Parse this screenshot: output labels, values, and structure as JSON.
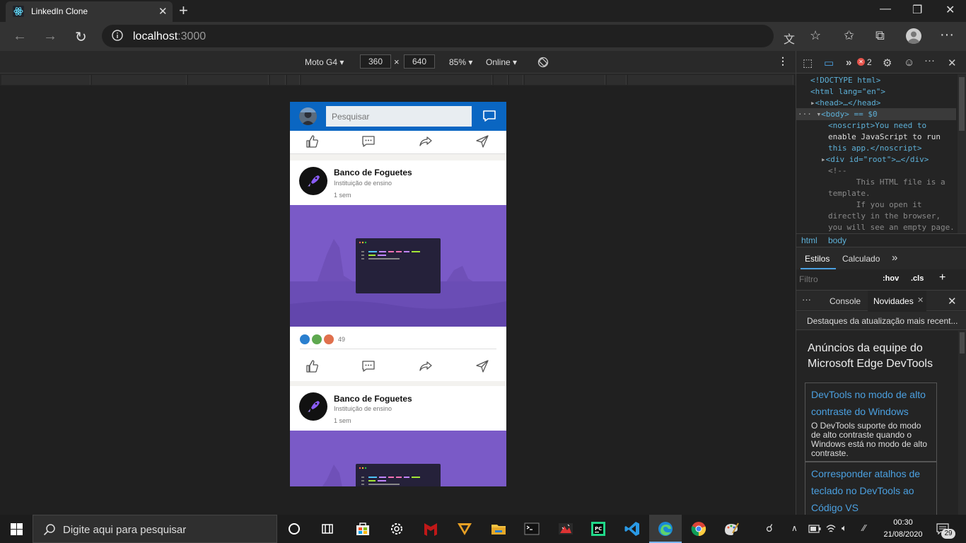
{
  "browser": {
    "tab_title": "LinkedIn Clone",
    "url_host": "localhost",
    "url_port": ":3000"
  },
  "device_toolbar": {
    "device": "Moto G4",
    "width": "360",
    "height": "640",
    "zoom": "85%",
    "throttling": "Online"
  },
  "app": {
    "search_placeholder": "Pesquisar",
    "posts": [
      {
        "company": "Banco de Foguetes",
        "subtitle": "Instituição de ensino",
        "time": "1 sem",
        "reactions": "49"
      },
      {
        "company": "Banco de Foguetes",
        "subtitle": "Instituição de ensino",
        "time": "1 sem"
      }
    ]
  },
  "devtools": {
    "error_count": "2",
    "dom_lines": [
      "<!DOCTYPE html>",
      "<html lang=\"en\">",
      "<head>…</head>",
      "<body> == $0",
      "<noscript>You need to",
      "enable JavaScript to run",
      "this app.</noscript>",
      "<div id=\"root\">…</div>",
      "<!--",
      "      This HTML file is a",
      "template.",
      "      If you open it",
      "directly in the browser,",
      "you will see an empty page."
    ],
    "breadcrumbs": [
      "html",
      "body"
    ],
    "styles_tabs": [
      "Estilos",
      "Calculado"
    ],
    "filter_placeholder": "Filtro",
    "hov": ":hov",
    "cls": ".cls",
    "drawer_tabs": [
      "Console",
      "Novidades"
    ],
    "news_header": "Destaques da atualização mais recent...",
    "news_title": "Anúncios da equipe do Microsoft Edge DevTools",
    "news_items": [
      {
        "heading": "DevTools no modo de alto contraste do Windows",
        "body": "O DevTools suporte do modo de alto contraste quando o Windows está no modo de alto contraste."
      },
      {
        "heading": "Corresponder atalhos de teclado no DevTools ao Código VS",
        "body": ""
      }
    ]
  },
  "taskbar": {
    "search_placeholder": "Digite aqui para pesquisar",
    "time": "00:30",
    "date": "21/08/2020",
    "notifications": "29"
  }
}
